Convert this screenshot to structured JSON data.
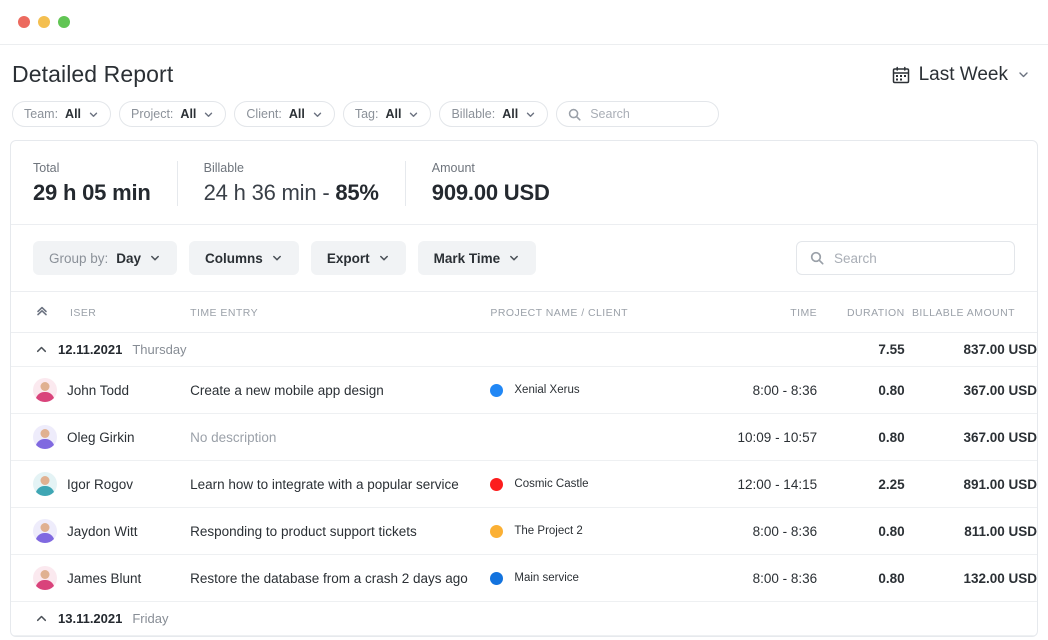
{
  "window": {
    "traffic_lights": [
      "close",
      "minimize",
      "zoom"
    ]
  },
  "header": {
    "title": "Detailed Report",
    "daterange": {
      "icon": "calendar-icon",
      "label": "Last Week",
      "chevron": "chevron-down-icon"
    }
  },
  "filters": [
    {
      "label": "Team:",
      "value": "All"
    },
    {
      "label": "Project:",
      "value": "All"
    },
    {
      "label": "Client:",
      "value": "All"
    },
    {
      "label": "Tag:",
      "value": "All"
    },
    {
      "label": "Billable:",
      "value": "All"
    }
  ],
  "filter_search": {
    "placeholder": "Search",
    "value": "",
    "icon": "search-icon"
  },
  "summary": [
    {
      "label": "Total",
      "value": "29 h 05 min"
    },
    {
      "label": "Billable",
      "value_muted": "24 h 36 min - ",
      "value": "85%"
    },
    {
      "label": "Amount",
      "value": "909.00 USD"
    }
  ],
  "toolbar": {
    "buttons": [
      {
        "prefix": "Group by:",
        "label": "Day",
        "name": "group-by-button"
      },
      {
        "prefix": "",
        "label": "Columns",
        "name": "columns-button"
      },
      {
        "prefix": "",
        "label": "Export",
        "name": "export-button"
      },
      {
        "prefix": "",
        "label": "Mark Time",
        "name": "mark-time-button"
      }
    ],
    "search": {
      "placeholder": "Search",
      "value": "",
      "icon": "search-icon"
    }
  },
  "table": {
    "columns": {
      "collapse": "",
      "user": "ISER",
      "entry": "TIME ENTRY",
      "project": "PROJECT NAME / CLIENT",
      "time": "TIME",
      "duration": "DURATION",
      "amount": "BILLABLE AMOUNT"
    },
    "groups": [
      {
        "date": "12.11.2021",
        "day": "Thursday",
        "duration": "7.55",
        "amount": "837.00 USD",
        "rows": [
          {
            "user": "John Todd",
            "avatar_color": "#d9437b",
            "entry": "Create a new mobile app design",
            "project": "Xenial Xerus",
            "project_color": "#2187f5",
            "time": "8:00 - 8:36",
            "duration": "0.80",
            "amount": "367.00 USD"
          },
          {
            "user": "Oleg Girkin",
            "avatar_color": "#8069e0",
            "entry": "No description",
            "entry_empty": true,
            "project": "",
            "project_color": "",
            "time": "10:09 - 10:57",
            "duration": "0.80",
            "amount": "367.00 USD"
          },
          {
            "user": "Igor Rogov",
            "avatar_color": "#3fa6b4",
            "entry": "Learn how to integrate with a popular service",
            "project": "Cosmic Castle",
            "project_color": "#fc1d1d",
            "time": "12:00 - 14:15",
            "duration": "2.25",
            "amount": "891.00 USD"
          },
          {
            "user": "Jaydon Witt",
            "avatar_color": "#8069e0",
            "entry": "Responding to product support tickets",
            "project": "The Project 2",
            "project_color": "#fbb034",
            "time": "8:00 - 8:36",
            "duration": "0.80",
            "amount": "811.00 USD"
          },
          {
            "user": "James Blunt",
            "avatar_color": "#d9437b",
            "entry": "Restore the database from a crash 2 days ago",
            "project": "Main service",
            "project_color": "#1373de",
            "time": "8:00 - 8:36",
            "duration": "0.80",
            "amount": "132.00 USD"
          }
        ]
      },
      {
        "date": "13.11.2021",
        "day": "Friday",
        "duration": "",
        "amount": "",
        "rows": []
      }
    ]
  },
  "colors": {
    "accent": "#1a73f0",
    "text": "#2b3035",
    "muted": "#9ba1a9",
    "border": "#e6e9ed"
  }
}
